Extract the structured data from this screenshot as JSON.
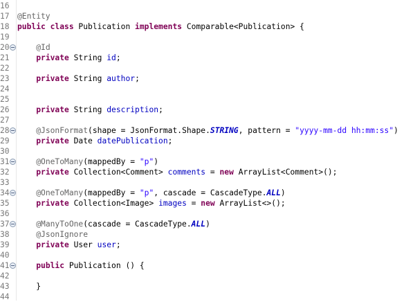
{
  "editor": {
    "lines": [
      {
        "n": "16",
        "fold": false,
        "tokens": []
      },
      {
        "n": "17",
        "fold": false,
        "tokens": [
          {
            "t": "@Entity",
            "c": "an"
          }
        ]
      },
      {
        "n": "18",
        "fold": false,
        "tokens": [
          {
            "t": "public class",
            "c": "kw"
          },
          {
            "t": " Publication ",
            "c": ""
          },
          {
            "t": "implements",
            "c": "kw"
          },
          {
            "t": " Comparable<Publication> {",
            "c": ""
          }
        ]
      },
      {
        "n": "19",
        "fold": false,
        "tokens": []
      },
      {
        "n": "20",
        "fold": true,
        "tokens": [
          {
            "t": "    ",
            "c": ""
          },
          {
            "t": "@Id",
            "c": "an"
          }
        ]
      },
      {
        "n": "21",
        "fold": false,
        "tokens": [
          {
            "t": "    ",
            "c": ""
          },
          {
            "t": "private",
            "c": "kw"
          },
          {
            "t": " String ",
            "c": ""
          },
          {
            "t": "id",
            "c": "fd"
          },
          {
            "t": ";",
            "c": ""
          }
        ]
      },
      {
        "n": "22",
        "fold": false,
        "tokens": []
      },
      {
        "n": "23",
        "fold": false,
        "tokens": [
          {
            "t": "    ",
            "c": ""
          },
          {
            "t": "private",
            "c": "kw"
          },
          {
            "t": " String ",
            "c": ""
          },
          {
            "t": "author",
            "c": "fd"
          },
          {
            "t": ";",
            "c": ""
          }
        ]
      },
      {
        "n": "24",
        "fold": false,
        "tokens": []
      },
      {
        "n": "25",
        "fold": false,
        "tokens": []
      },
      {
        "n": "26",
        "fold": false,
        "tokens": [
          {
            "t": "    ",
            "c": ""
          },
          {
            "t": "private",
            "c": "kw"
          },
          {
            "t": " String ",
            "c": ""
          },
          {
            "t": "description",
            "c": "fd"
          },
          {
            "t": ";",
            "c": ""
          }
        ]
      },
      {
        "n": "27",
        "fold": false,
        "tokens": []
      },
      {
        "n": "28",
        "fold": true,
        "tokens": [
          {
            "t": "    ",
            "c": ""
          },
          {
            "t": "@JsonFormat",
            "c": "an"
          },
          {
            "t": "(shape = JsonFormat.Shape.",
            "c": ""
          },
          {
            "t": "STRING",
            "c": "cn"
          },
          {
            "t": ", pattern = ",
            "c": ""
          },
          {
            "t": "\"yyyy-mm-dd hh:mm:ss\"",
            "c": "st"
          },
          {
            "t": ")",
            "c": ""
          }
        ]
      },
      {
        "n": "29",
        "fold": false,
        "tokens": [
          {
            "t": "    ",
            "c": ""
          },
          {
            "t": "private",
            "c": "kw"
          },
          {
            "t": " Date ",
            "c": ""
          },
          {
            "t": "datePublication",
            "c": "fd"
          },
          {
            "t": ";",
            "c": ""
          }
        ]
      },
      {
        "n": "30",
        "fold": false,
        "tokens": []
      },
      {
        "n": "31",
        "fold": true,
        "tokens": [
          {
            "t": "    ",
            "c": ""
          },
          {
            "t": "@OneToMany",
            "c": "an"
          },
          {
            "t": "(mappedBy = ",
            "c": ""
          },
          {
            "t": "\"p\"",
            "c": "st"
          },
          {
            "t": ")",
            "c": ""
          }
        ]
      },
      {
        "n": "32",
        "fold": false,
        "tokens": [
          {
            "t": "    ",
            "c": ""
          },
          {
            "t": "private",
            "c": "kw"
          },
          {
            "t": " Collection<Comment> ",
            "c": ""
          },
          {
            "t": "comments",
            "c": "fd"
          },
          {
            "t": " = ",
            "c": ""
          },
          {
            "t": "new",
            "c": "kw"
          },
          {
            "t": " ArrayList<Comment>();",
            "c": ""
          }
        ]
      },
      {
        "n": "33",
        "fold": false,
        "tokens": []
      },
      {
        "n": "34",
        "fold": true,
        "tokens": [
          {
            "t": "    ",
            "c": ""
          },
          {
            "t": "@OneToMany",
            "c": "an"
          },
          {
            "t": "(mappedBy = ",
            "c": ""
          },
          {
            "t": "\"p\"",
            "c": "st"
          },
          {
            "t": ", cascade = CascadeType.",
            "c": ""
          },
          {
            "t": "ALL",
            "c": "cn"
          },
          {
            "t": ")",
            "c": ""
          }
        ]
      },
      {
        "n": "35",
        "fold": false,
        "tokens": [
          {
            "t": "    ",
            "c": ""
          },
          {
            "t": "private",
            "c": "kw"
          },
          {
            "t": " Collection<Image> ",
            "c": ""
          },
          {
            "t": "images",
            "c": "fd"
          },
          {
            "t": " = ",
            "c": ""
          },
          {
            "t": "new",
            "c": "kw"
          },
          {
            "t": " ArrayList<>();",
            "c": ""
          }
        ]
      },
      {
        "n": "36",
        "fold": false,
        "tokens": []
      },
      {
        "n": "37",
        "fold": true,
        "tokens": [
          {
            "t": "    ",
            "c": ""
          },
          {
            "t": "@ManyToOne",
            "c": "an"
          },
          {
            "t": "(cascade = CascadeType.",
            "c": ""
          },
          {
            "t": "ALL",
            "c": "cn"
          },
          {
            "t": ")",
            "c": ""
          }
        ]
      },
      {
        "n": "38",
        "fold": false,
        "tokens": [
          {
            "t": "    ",
            "c": ""
          },
          {
            "t": "@JsonIgnore",
            "c": "an"
          }
        ]
      },
      {
        "n": "39",
        "fold": false,
        "tokens": [
          {
            "t": "    ",
            "c": ""
          },
          {
            "t": "private",
            "c": "kw"
          },
          {
            "t": " User ",
            "c": ""
          },
          {
            "t": "user",
            "c": "fd"
          },
          {
            "t": ";",
            "c": ""
          }
        ]
      },
      {
        "n": "40",
        "fold": false,
        "tokens": []
      },
      {
        "n": "41",
        "fold": true,
        "tokens": [
          {
            "t": "    ",
            "c": ""
          },
          {
            "t": "public",
            "c": "kw"
          },
          {
            "t": " Publication () {",
            "c": ""
          }
        ]
      },
      {
        "n": "42",
        "fold": false,
        "tokens": []
      },
      {
        "n": "43",
        "fold": false,
        "tokens": [
          {
            "t": "    }",
            "c": ""
          }
        ]
      },
      {
        "n": "44",
        "fold": false,
        "tokens": []
      }
    ]
  }
}
